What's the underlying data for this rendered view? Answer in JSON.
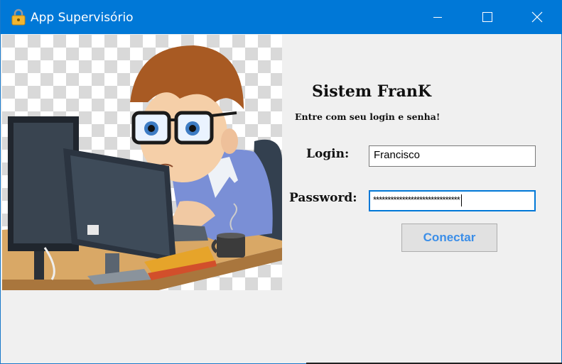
{
  "window": {
    "title": "App Supervisório",
    "accent": "#0078d7"
  },
  "controls": {
    "minimize": "minimize-icon",
    "maximize": "maximize-icon",
    "close": "close-icon"
  },
  "form": {
    "heading": "Sistem FranK",
    "subtitle": "Entre com seu login e senha!",
    "login_label": "Login:",
    "login_value": "Francisco",
    "password_label": "Password:",
    "password_value": "******************************",
    "connect_label": "Conectar"
  },
  "illustration": {
    "name": "programmer-illustration"
  }
}
